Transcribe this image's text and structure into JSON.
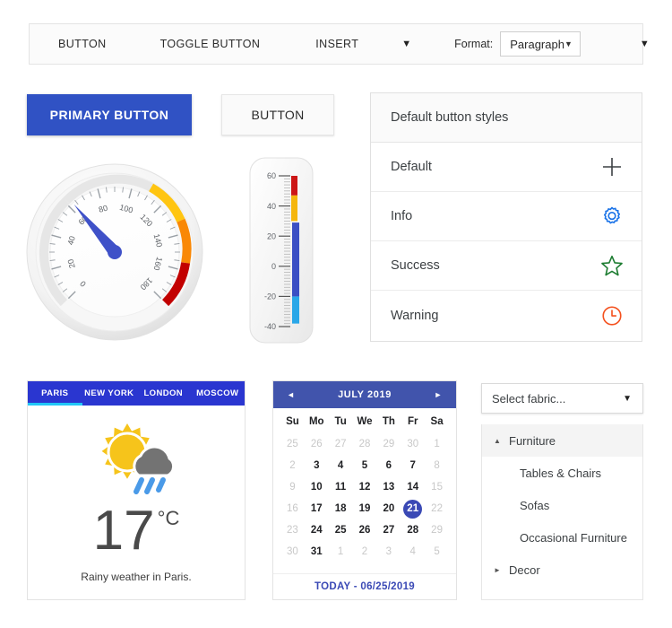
{
  "toolbar": {
    "button_label": "BUTTON",
    "toggle_button_label": "TOGGLE BUTTON",
    "insert_label": "INSERT",
    "insert_caret": "▼",
    "format_label": "Format:",
    "format_value": "Paragraph",
    "format_caret": "▼",
    "end_caret": "▼"
  },
  "buttons": {
    "primary_label": "PRIMARY BUTTON",
    "flat_label": "BUTTON",
    "primary_color": "#3052c4"
  },
  "list_panel": {
    "header": "Default button styles",
    "rows": [
      {
        "label": "Default",
        "icon": "plus-icon",
        "color": "#3c4043"
      },
      {
        "label": "Info",
        "icon": "gear-icon",
        "color": "#1a73e8"
      },
      {
        "label": "Success",
        "icon": "star-icon",
        "color": "#1e7d32"
      },
      {
        "label": "Warning",
        "icon": "clock-icon",
        "color": "#f4511e"
      }
    ]
  },
  "gauge": {
    "min": 0,
    "max": 180,
    "value": 63,
    "tick_labels": [
      "0",
      "20",
      "40",
      "60",
      "80",
      "100",
      "120",
      "140",
      "160",
      "180"
    ],
    "needle_color": "#3f51c8",
    "bands": [
      {
        "from": 0,
        "to": 75,
        "color": "#e6e6e6"
      },
      {
        "from": 75,
        "to": 113,
        "color": "#ffc511"
      },
      {
        "from": 113,
        "to": 150,
        "color": "#f98806"
      },
      {
        "from": 150,
        "to": 180,
        "color": "#c20000"
      }
    ]
  },
  "thermometer": {
    "min": -40,
    "max": 60,
    "value": 29,
    "tick_labels": [
      "60",
      "40",
      "20",
      "0",
      "-20",
      "-40"
    ],
    "bands": [
      {
        "from": 47,
        "to": 60,
        "color": "#cc1616"
      },
      {
        "from": 30,
        "to": 47,
        "color": "#f5b60d"
      }
    ],
    "bar_color": "#3b4fc4",
    "bar_low_color": "#2aa7e8"
  },
  "weather": {
    "tabs": [
      {
        "label": "PARIS",
        "active": true
      },
      {
        "label": "NEW YORK",
        "active": false
      },
      {
        "label": "LONDON",
        "active": false
      },
      {
        "label": "MOSCOW",
        "active": false
      }
    ],
    "icon": "sun-behind-rain-cloud-icon",
    "temperature": "17",
    "unit": "°C",
    "description": "Rainy weather in Paris.",
    "tabbar_color": "#2a36d0",
    "active_underline_color": "#22c6f7"
  },
  "calendar": {
    "title": "JULY 2019",
    "prev_icon": "◄",
    "next_icon": "►",
    "dow": [
      "Su",
      "Mo",
      "Tu",
      "We",
      "Th",
      "Fr",
      "Sa"
    ],
    "weeks": [
      [
        {
          "d": "25",
          "muted": true
        },
        {
          "d": "26",
          "muted": true
        },
        {
          "d": "27",
          "muted": true
        },
        {
          "d": "28",
          "muted": true
        },
        {
          "d": "29",
          "muted": true
        },
        {
          "d": "30",
          "muted": true
        },
        {
          "d": "1",
          "muted": true
        }
      ],
      [
        {
          "d": "2",
          "muted": true
        },
        {
          "d": "3",
          "muted": false
        },
        {
          "d": "4",
          "muted": false
        },
        {
          "d": "5",
          "muted": false
        },
        {
          "d": "6",
          "muted": false
        },
        {
          "d": "7",
          "muted": false
        },
        {
          "d": "8",
          "muted": true
        }
      ],
      [
        {
          "d": "9",
          "muted": true
        },
        {
          "d": "10",
          "muted": false
        },
        {
          "d": "11",
          "muted": false
        },
        {
          "d": "12",
          "muted": false
        },
        {
          "d": "13",
          "muted": false
        },
        {
          "d": "14",
          "muted": false
        },
        {
          "d": "15",
          "muted": true
        }
      ],
      [
        {
          "d": "16",
          "muted": true
        },
        {
          "d": "17",
          "muted": false
        },
        {
          "d": "18",
          "muted": false
        },
        {
          "d": "19",
          "muted": false
        },
        {
          "d": "20",
          "muted": false
        },
        {
          "d": "21",
          "muted": false,
          "selected": true
        },
        {
          "d": "22",
          "muted": true
        }
      ],
      [
        {
          "d": "23",
          "muted": true
        },
        {
          "d": "24",
          "muted": false
        },
        {
          "d": "25",
          "muted": false
        },
        {
          "d": "26",
          "muted": false
        },
        {
          "d": "27",
          "muted": false
        },
        {
          "d": "28",
          "muted": false
        },
        {
          "d": "29",
          "muted": true
        }
      ],
      [
        {
          "d": "30",
          "muted": true
        },
        {
          "d": "31",
          "muted": false
        },
        {
          "d": "1",
          "muted": true
        },
        {
          "d": "2",
          "muted": true
        },
        {
          "d": "3",
          "muted": true
        },
        {
          "d": "4",
          "muted": true
        },
        {
          "d": "5",
          "muted": true
        }
      ]
    ],
    "footer": "TODAY - 06/25/2019",
    "header_color": "#4154ac",
    "selected_color": "#3a49b5"
  },
  "fabric": {
    "placeholder": "Select fabric...",
    "caret": "▼",
    "tree": [
      {
        "label": "Furniture",
        "type": "group",
        "arrow": "▲",
        "expanded": true
      },
      {
        "label": "Tables & Chairs",
        "type": "child"
      },
      {
        "label": "Sofas",
        "type": "child"
      },
      {
        "label": "Occasional Furniture",
        "type": "child"
      },
      {
        "label": "Decor",
        "type": "group",
        "arrow": "►",
        "expanded": false
      }
    ]
  }
}
